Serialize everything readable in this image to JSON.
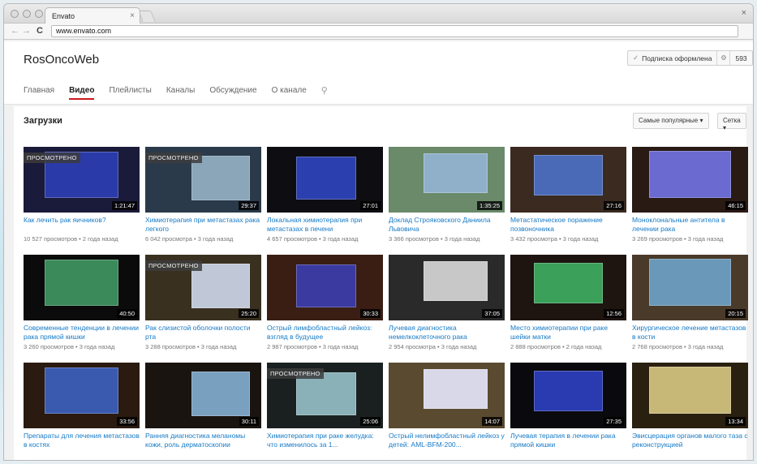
{
  "browser": {
    "tab_title": "Envato",
    "url": "www.envato.com"
  },
  "channel": {
    "title": "RosOncoWeb",
    "subscribe_label": "Подписка оформлена",
    "subscriber_count": "593",
    "tabs": [
      "Главная",
      "Видео",
      "Плейлисты",
      "Каналы",
      "Обсуждение",
      "О канале"
    ],
    "active_tab": "Видео"
  },
  "uploads": {
    "title": "Загрузки",
    "sort_label": "Самые популярные",
    "view_label": "Сетка"
  },
  "watched_label": "ПРОСМОТРЕНО",
  "videos": [
    {
      "title": "Как лечить рак яичников?",
      "meta": "10 527 просмотров • 2 года назад",
      "duration": "1:21:47",
      "watched": true,
      "bg": "#1a1a3a",
      "screen": "#2a3aa8"
    },
    {
      "title": "Химиотерапия при метастазах рака легкого",
      "meta": "6 042 просмотра • 3 года назад",
      "duration": "29:37",
      "watched": true,
      "bg": "#2b3a4a",
      "screen": "#8aa6b8"
    },
    {
      "title": "Локальная химиотерапия при метастазах в печени",
      "meta": "4 657 просмотров • 3 года назад",
      "duration": "27:01",
      "watched": false,
      "bg": "#0e0e12",
      "screen": "#2b3fae"
    },
    {
      "title": "Доклад Строяковского Даниила Львовича",
      "meta": "3 366 просмотров • 3 года назад",
      "duration": "1:35:25",
      "watched": false,
      "bg": "#6a8a6a",
      "screen": "#8fb0c8"
    },
    {
      "title": "Метастатическое поражение позвоночника",
      "meta": "3 432 просмотра • 3 года назад",
      "duration": "27:16",
      "watched": false,
      "bg": "#3a2a20",
      "screen": "#4a6ab8"
    },
    {
      "title": "Моноклональные антитела в лечении рака",
      "meta": "3 269 просмотров • 3 года назад",
      "duration": "46:15",
      "watched": false,
      "bg": "#2a1a14",
      "screen": "#6a6ad0"
    },
    {
      "title": "Современные тенденции в лечении рака прямой кишки",
      "meta": "3 260 просмотров • 3 года назад",
      "duration": "40:50",
      "watched": false,
      "bg": "#0b0b0b",
      "screen": "#3a8a5a"
    },
    {
      "title": "Рак слизистой оболочки полости рта",
      "meta": "3 288 просмотров • 3 года назад",
      "duration": "25:20",
      "watched": true,
      "bg": "#3a3020",
      "screen": "#c0c8d8"
    },
    {
      "title": "Острый лимфобластный лейкоз: взгляд в будущее",
      "meta": "2 987 просмотров • 3 года назад",
      "duration": "30:33",
      "watched": false,
      "bg": "#3a1e14",
      "screen": "#3a3aa0"
    },
    {
      "title": "Лучевая диагностика немелкоклеточного рака",
      "meta": "2 954 просмотра • 3 года назад",
      "duration": "37:05",
      "watched": false,
      "bg": "#2a2a2a",
      "screen": "#c8c8c8"
    },
    {
      "title": "Место химиотерапии при раке шейки матки",
      "meta": "2 888 просмотров • 2 года назад",
      "duration": "12:56",
      "watched": false,
      "bg": "#1e1410",
      "screen": "#3aa05a"
    },
    {
      "title": "Хирургическое лечение метастазов в кости",
      "meta": "2 768 просмотров • 3 года назад",
      "duration": "20:15",
      "watched": false,
      "bg": "#4a3a2a",
      "screen": "#6a98b8"
    },
    {
      "title": "Препараты для лечения метастазов в костях",
      "meta": "",
      "duration": "33:56",
      "watched": false,
      "bg": "#2a1a10",
      "screen": "#3a5ab0"
    },
    {
      "title": "Ранняя диагностика меланомы кожи, роль дерматоскопии",
      "meta": "",
      "duration": "30:11",
      "watched": false,
      "bg": "#1a1410",
      "screen": "#7aa0c0"
    },
    {
      "title": "Химиотерапия при раке желудка: что изменилось за 1...",
      "meta": "",
      "duration": "25:06",
      "watched": true,
      "bg": "#1a2020",
      "screen": "#8ab0b8"
    },
    {
      "title": "Острый нелимфобластный лейкоз у детей: AML-BFM-200...",
      "meta": "",
      "duration": "14:07",
      "watched": false,
      "bg": "#5a4a30",
      "screen": "#d8d8e8"
    },
    {
      "title": "Лучевая терапия в лечении рака прямой кишки",
      "meta": "",
      "duration": "27:35",
      "watched": false,
      "bg": "#0a0a0e",
      "screen": "#2a3ab0"
    },
    {
      "title": "Эвисцерация органов малого таза с реконструкцией",
      "meta": "",
      "duration": "13:34",
      "watched": false,
      "bg": "#2a2010",
      "screen": "#c8b878"
    }
  ]
}
